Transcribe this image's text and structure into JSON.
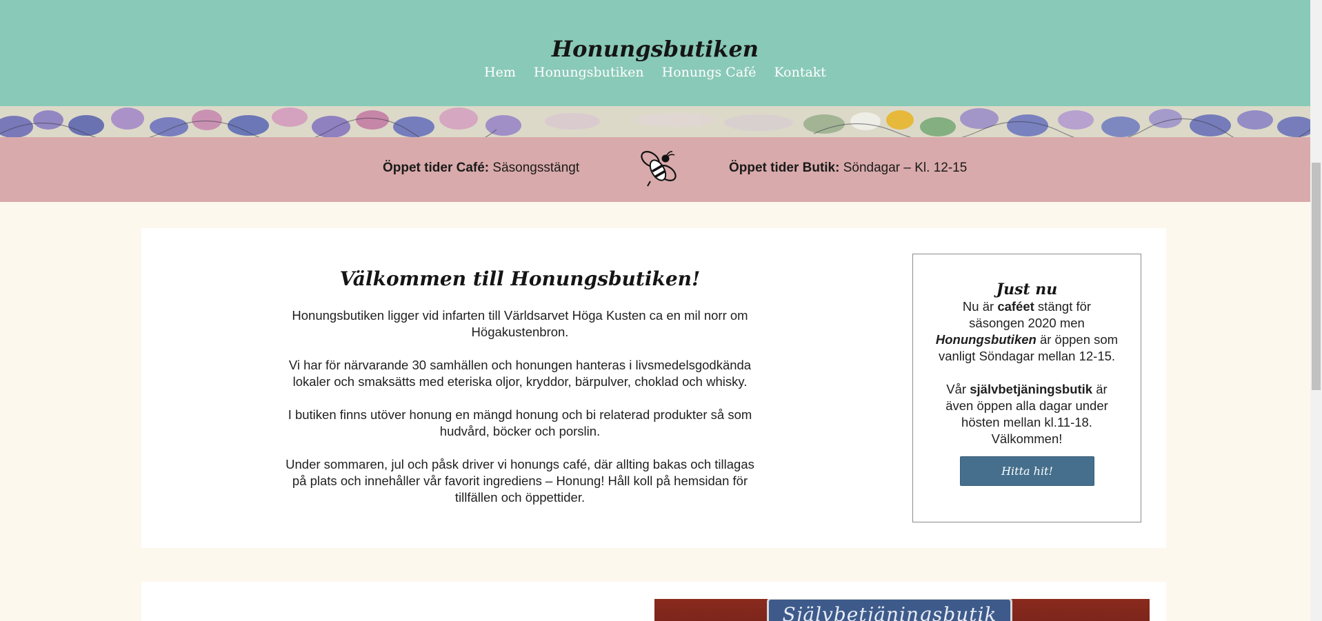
{
  "header": {
    "site_title": "Honungsbutiken",
    "nav": [
      "Hem",
      "Honungsbutiken",
      "Honungs Café",
      "Kontakt"
    ]
  },
  "hours": {
    "cafe_label": "Öppet tider Café:",
    "cafe_value": "Säsongsstängt",
    "shop_label": "Öppet tider Butik:",
    "shop_value": "Söndagar – Kl. 12-15"
  },
  "welcome": {
    "title": "Välkommen till Honungsbutiken!",
    "paragraphs": [
      "Honungsbutiken ligger vid infarten till Världsarvet Höga Kusten ca en mil norr om Högakustenbron.",
      "Vi har för närvarande 30 samhällen och honungen hanteras i livsmedelsgodkända lokaler och smaksätts med eteriska oljor, kryddor, bärpulver, choklad och whisky.",
      "I butiken finns utöver honung en mängd honung och bi relaterad produkter så som hudvård, böcker och porslin.",
      "Under sommaren, jul och påsk driver vi honungs café, där allting bakas och tillagas på plats och innehåller vår favorit ingrediens – Honung! Håll koll på hemsidan för tillfällen och öppettider."
    ]
  },
  "just_now": {
    "title": "Just nu",
    "p1_pre": "Nu är ",
    "p1_bold": "caféet",
    "p1_mid": " stängt för säsongen 2020 men ",
    "p1_bold_italic": "Honungsbutiken",
    "p1_post": " är öppen som vanligt Söndagar mellan 12-15.",
    "p2_pre": "Vår ",
    "p2_bold": "självbetjäningsbutik",
    "p2_post": " är även öppen alla dagar under hösten mellan kl.11-18.",
    "p2_end": "Välkommen!",
    "button": "Hitta hit!"
  },
  "photo": {
    "sign_text": "Självbetjäningsbutik"
  }
}
